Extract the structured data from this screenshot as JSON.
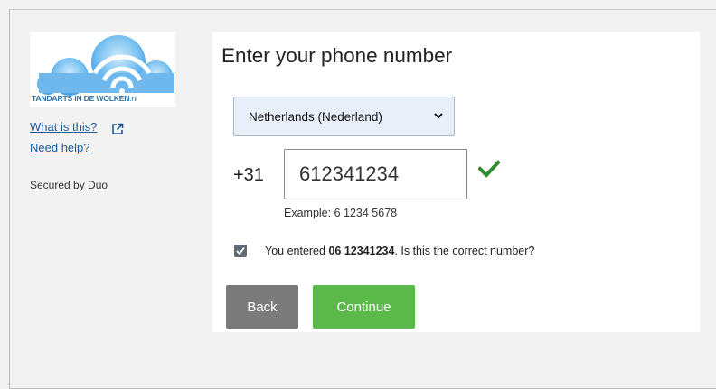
{
  "sidebar": {
    "logo_text_main": "TANDARTS IN DE WOLKEN",
    "logo_text_suffix": ".nl",
    "what_is_this": "What is this?",
    "need_help": "Need help?",
    "secured_by": "Secured by Duo"
  },
  "main": {
    "title": "Enter your phone number",
    "country_select": "Netherlands (Nederland)",
    "country_code": "+31",
    "phone_value": "612341234",
    "example": "Example: 6 1234 5678",
    "confirm_prefix": "You entered ",
    "confirm_number": "06 12341234",
    "confirm_suffix": ". Is this the correct number?",
    "confirm_checked": true,
    "back_label": "Back",
    "continue_label": "Continue"
  },
  "colors": {
    "link": "#1e5b9a",
    "continue_button": "#5bb94a",
    "back_button": "#7b7b7b",
    "valid_check": "#2e8b2e"
  },
  "icons": [
    "logo-cloud-wifi",
    "external-link-icon",
    "chevron-down-icon",
    "valid-check-icon",
    "checkbox-check-icon"
  ]
}
